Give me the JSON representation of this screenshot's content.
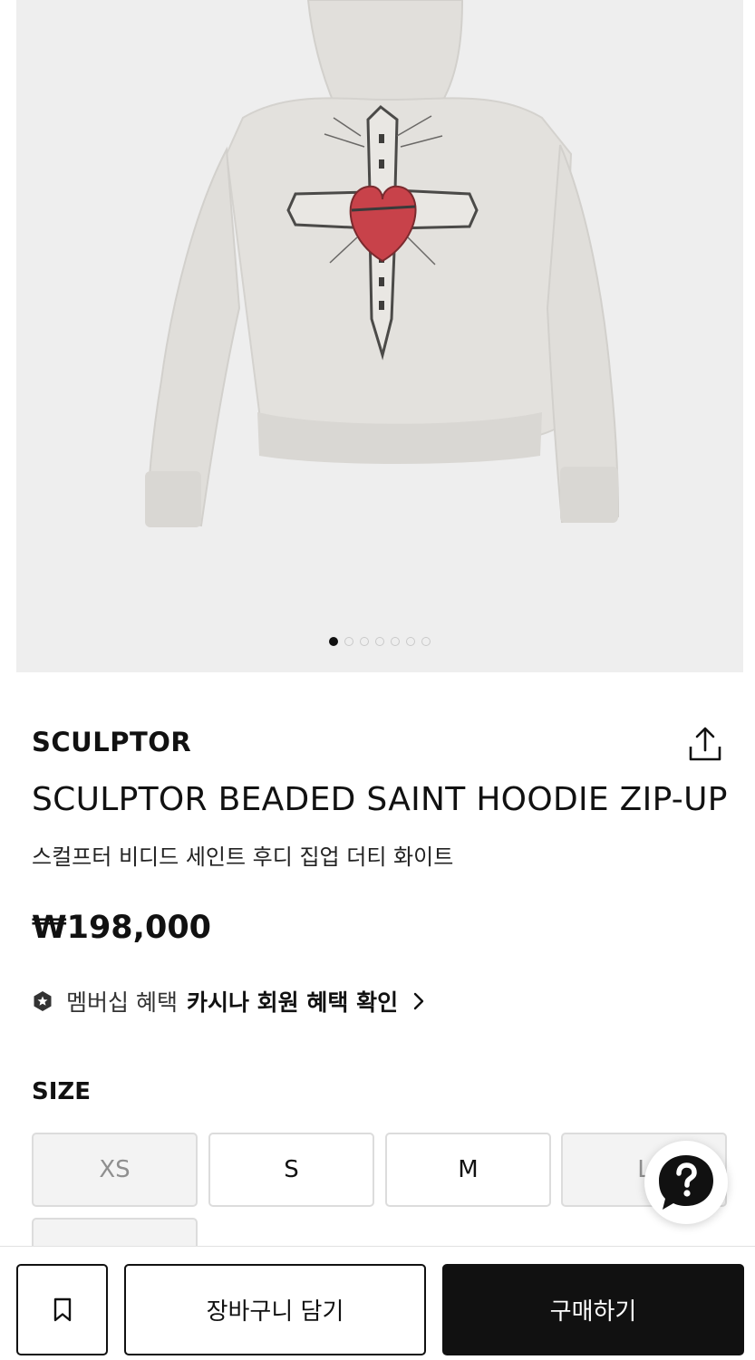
{
  "product": {
    "brand": "SCULPTOR",
    "title": "SCULPTOR BEADED SAINT HOODIE ZIP-UP",
    "subtitle": "스컬프터 비디드 세인트 후디 집업 더티 화이트",
    "price": "₩198,000",
    "image_alt": "hoodie back view with beaded cross and heart graphic"
  },
  "carousel": {
    "total": 7,
    "active": 1
  },
  "benefit": {
    "muted": "멤버십 혜택",
    "strong": "카시나 회원 혜택 확인"
  },
  "size": {
    "label": "SIZE",
    "options": [
      {
        "label": "XS",
        "available": false
      },
      {
        "label": "S",
        "available": true
      },
      {
        "label": "M",
        "available": true
      },
      {
        "label": "L",
        "available": false
      }
    ]
  },
  "actions": {
    "cart": "장바구니 담기",
    "buy": "구매하기"
  },
  "icons": [
    "share-icon",
    "membership-badge-icon",
    "chevron-right-icon",
    "help-chat-icon",
    "bookmark-icon"
  ],
  "colors": {
    "accent": "#111111",
    "image_bg": "#eeeeee",
    "heart": "#c8424a"
  }
}
